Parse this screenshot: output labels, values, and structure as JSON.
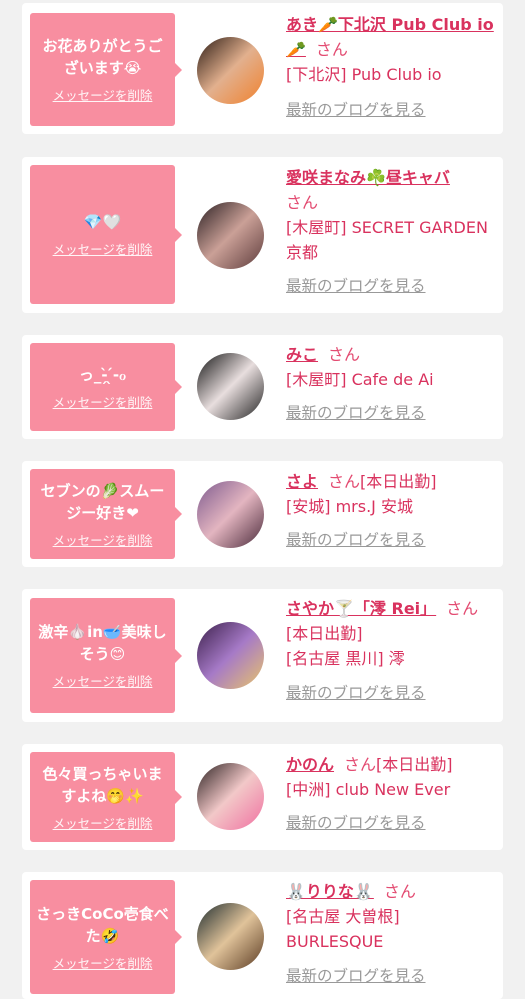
{
  "messages": [
    {
      "message": "お花ありがとうございます😭",
      "delete_label": "メッセージを削除",
      "name": "あき🥕下北沢 Pub Club io🥕",
      "honorific": "さん",
      "status": "",
      "shop": "[下北沢] Pub Club io",
      "blog_link": "最新のブログを見る"
    },
    {
      "message": "💎🤍",
      "delete_label": "メッセージを削除",
      "name": "愛咲まなみ☘️昼キャバ",
      "honorific": "さん",
      "status": "",
      "shop": "[木屋町] SECRET GARDEN 京都",
      "blog_link": "最新のブログを見る"
    },
    {
      "message": "っ_-̗̀ ̖́-ℴ",
      "delete_label": "メッセージを削除",
      "name": "みこ",
      "honorific": "さん",
      "status": "",
      "shop": "[木屋町] Cafe de Ai",
      "blog_link": "最新のブログを見る"
    },
    {
      "message": "セブンの🥬スムージー好き❤",
      "delete_label": "メッセージを削除",
      "name": "さよ",
      "honorific": "さん",
      "status": "[本日出勤]",
      "shop": "[安城] mrs.J 安城",
      "blog_link": "最新のブログを見る"
    },
    {
      "message": "激辛🧄in🥣美味しそう😊",
      "delete_label": "メッセージを削除",
      "name": "さやか🍸「澪 Rei」",
      "honorific": "さん",
      "status": "[本日出勤]",
      "shop": "[名古屋 黒川] 澪",
      "blog_link": "最新のブログを見る"
    },
    {
      "message": "色々買っちゃいますよね🤭✨",
      "delete_label": "メッセージを削除",
      "name": "かのん",
      "honorific": "さん",
      "status": "[本日出勤]",
      "shop": "[中洲] club New Ever",
      "blog_link": "最新のブログを見る"
    },
    {
      "message": "さっきCoCo壱食べた🤣",
      "delete_label": "メッセージを削除",
      "name": "🐰りりな🐰",
      "honorific": "さん",
      "status": "",
      "shop": "[名古屋 大曽根] BURLESQUE",
      "blog_link": "最新のブログを見る"
    }
  ]
}
